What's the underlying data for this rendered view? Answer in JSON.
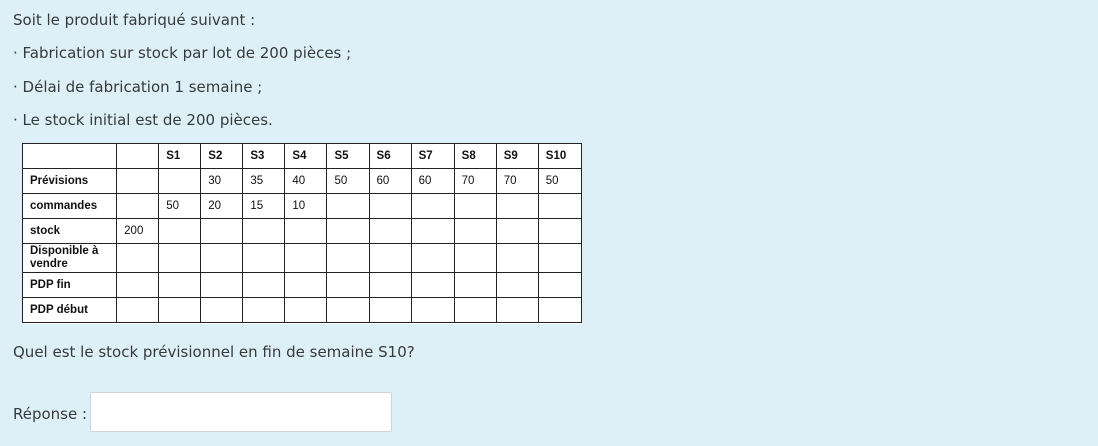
{
  "intro": [
    "Soit le produit fabriqué suivant :",
    "· Fabrication sur stock par lot de 200 pièces ;",
    "· Délai de fabrication 1 semaine ;",
    "· Le stock initial est de 200 pièces."
  ],
  "table": {
    "columns": [
      "",
      "",
      "S1",
      "S2",
      "S3",
      "S4",
      "S5",
      "S6",
      "S7",
      "S8",
      "S9",
      "S10"
    ],
    "rows": [
      {
        "label": "Prévisions",
        "cells": [
          "",
          "",
          "30",
          "35",
          "40",
          "50",
          "60",
          "60",
          "70",
          "70",
          "50"
        ]
      },
      {
        "label": "commandes",
        "cells": [
          "",
          "50",
          "20",
          "15",
          "10",
          "",
          "",
          "",
          "",
          "",
          ""
        ]
      },
      {
        "label": "stock",
        "cells": [
          "200",
          "",
          "",
          "",
          "",
          "",
          "",
          "",
          "",
          "",
          ""
        ]
      },
      {
        "label": "Disponible à vendre",
        "cells": [
          "",
          "",
          "",
          "",
          "",
          "",
          "",
          "",
          "",
          "",
          ""
        ]
      },
      {
        "label": "PDP fin",
        "cells": [
          "",
          "",
          "",
          "",
          "",
          "",
          "",
          "",
          "",
          "",
          ""
        ]
      },
      {
        "label": "PDP début",
        "cells": [
          "",
          "",
          "",
          "",
          "",
          "",
          "",
          "",
          "",
          "",
          ""
        ]
      }
    ]
  },
  "question": "Quel est le stock prévisionnel en fin de semaine S10?",
  "answer": {
    "label": "Réponse :",
    "value": ""
  }
}
